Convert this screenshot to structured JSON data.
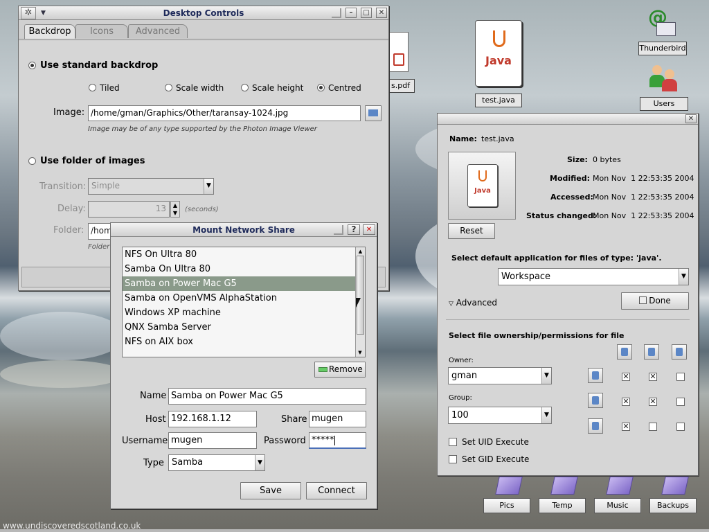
{
  "desktop": {
    "footer_url": "www.undiscoveredscotland.co.uk",
    "icons": [
      {
        "name": "test.java",
        "img_text": "Java"
      },
      {
        "name": "Thunderbird"
      },
      {
        "name": "Users"
      },
      {
        "name": "s.pdf"
      }
    ],
    "folders": [
      "Pics",
      "Temp",
      "Music",
      "Backups"
    ]
  },
  "desktop_controls": {
    "title": "Desktop Controls",
    "tabs": [
      "Backdrop",
      "Icons",
      "Advanced"
    ],
    "use_standard_backdrop": "Use standard backdrop",
    "modes": [
      "Tiled",
      "Scale width",
      "Scale height",
      "Centred"
    ],
    "selected_mode": "Centred",
    "image_label": "Image:",
    "image_value": "/home/gman/Graphics/Other/taransay-1024.jpg",
    "image_hint": "Image may be of any type supported by the Photon Image Viewer",
    "use_folder": "Use folder of images",
    "transition_label": "Transition:",
    "transition_value": "Simple",
    "delay_label": "Delay:",
    "delay_value": "13",
    "delay_unit": "(seconds)",
    "folder_label": "Folder:",
    "folder_value": "/hom",
    "folder_hint": "Folder"
  },
  "mount_share": {
    "title": "Mount Network Share",
    "help_label": "?",
    "shares": [
      "NFS On Ultra 80",
      "Samba On Ultra 80",
      "Samba on Power Mac G5",
      "Samba on OpenVMS AlphaStation",
      "Windows XP machine",
      "QNX Samba Server",
      "NFS on AIX box"
    ],
    "selected_index": 2,
    "remove_label": "Remove",
    "name_label": "Name",
    "name_value": "Samba on Power Mac G5",
    "host_label": "Host",
    "host_value": "192.168.1.12",
    "share_label": "Share",
    "share_value": "mugen",
    "username_label": "Username",
    "username_value": "mugen",
    "password_label": "Password",
    "password_value": "*****",
    "type_label": "Type",
    "type_value": "Samba",
    "save_label": "Save",
    "connect_label": "Connect"
  },
  "file_info": {
    "name_label": "Name:",
    "name_value": "test.java",
    "preview_text": "Java",
    "size_label": "Size:",
    "size_value": "0 bytes",
    "modified_label": "Modified:",
    "modified_value": "Mon Nov  1 22:53:35 2004",
    "accessed_label": "Accessed:",
    "accessed_value": "Mon Nov  1 22:53:35 2004",
    "status_label": "Status changed:",
    "status_value": "Mon Nov  1 22:53:35 2004",
    "reset_label": "Reset",
    "default_app_label": "Select default application for files of type: 'java'.",
    "default_app_value": "Workspace",
    "advanced_label": "Advanced",
    "done_label": "Done",
    "ownership_label": "Select file ownership/permissions for file",
    "owner_label": "Owner:",
    "owner_value": "gman",
    "group_label": "Group:",
    "group_value": "100",
    "setuid_label": "Set UID Execute",
    "setgid_label": "Set GID Execute",
    "permissions": [
      [
        true,
        true,
        false
      ],
      [
        true,
        true,
        false
      ],
      [
        true,
        false,
        false
      ]
    ]
  }
}
